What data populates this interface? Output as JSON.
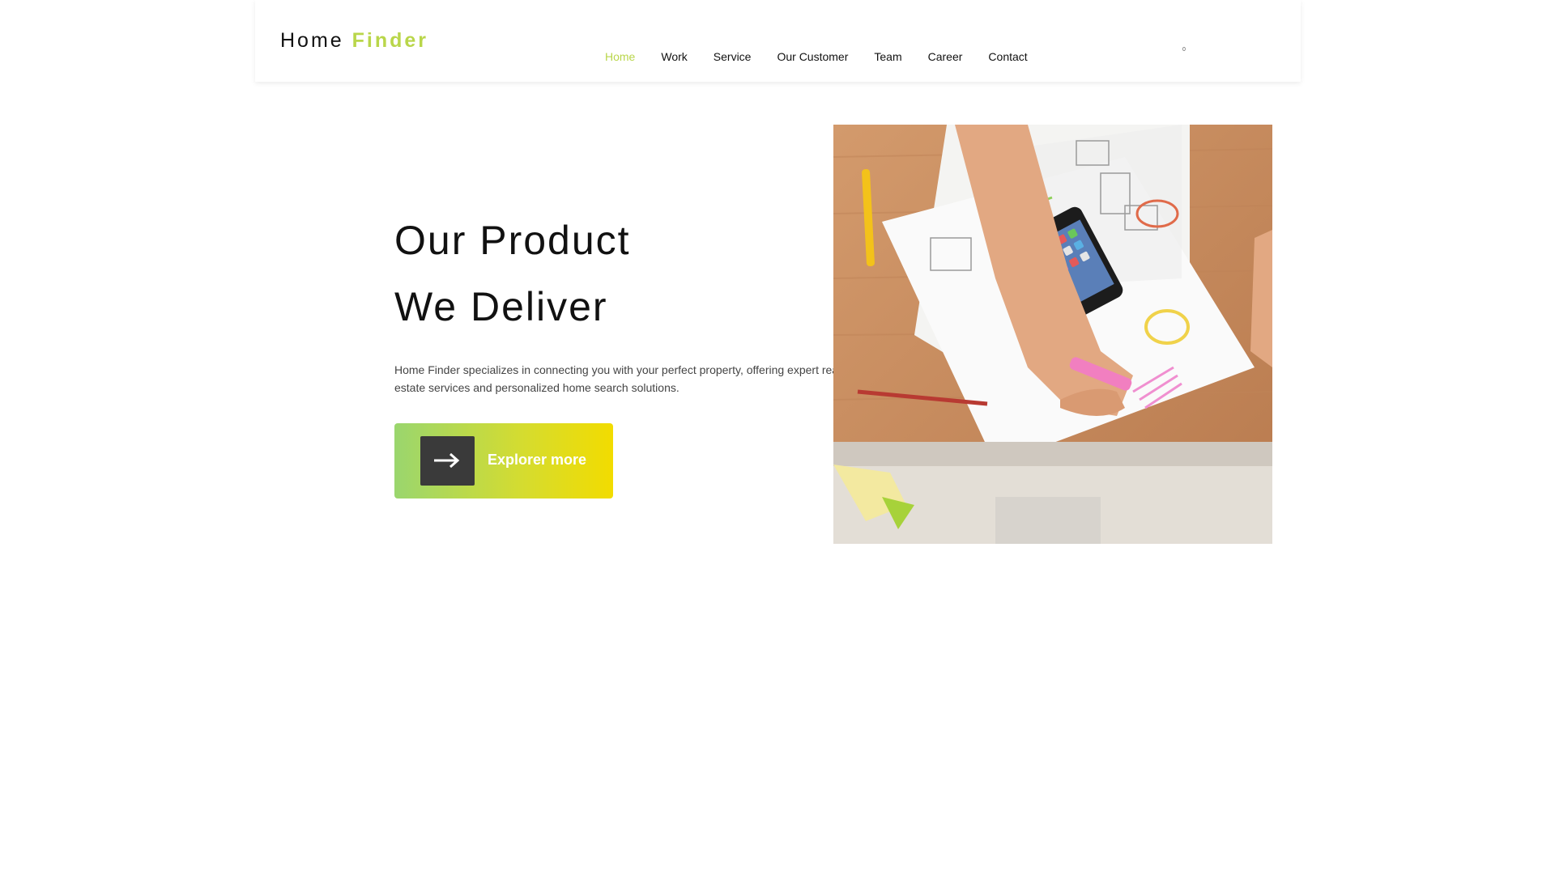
{
  "header": {
    "logo_part1": "Home",
    "logo_part2": "Finder",
    "nav": [
      "Home",
      "Work",
      "Service",
      "Our Customer",
      "Team",
      "Career",
      "Contact"
    ],
    "active_nav": "Home",
    "tiny_marker": "0"
  },
  "hero": {
    "title_line1": "Our Product",
    "title_line2": "We Deliver",
    "description": "Home Finder specializes in connecting you with your perfect property, offering expert real estate services and personalized home search solutions.",
    "cta_label": "Explorer more"
  },
  "colors": {
    "accent": "#b9d64a",
    "gradient_start": "#9ad66e",
    "gradient_end": "#f2dc00",
    "text": "#111111",
    "arrow_box": "#3a3a3a"
  },
  "icons": {
    "cta": "arrow-right-icon"
  }
}
